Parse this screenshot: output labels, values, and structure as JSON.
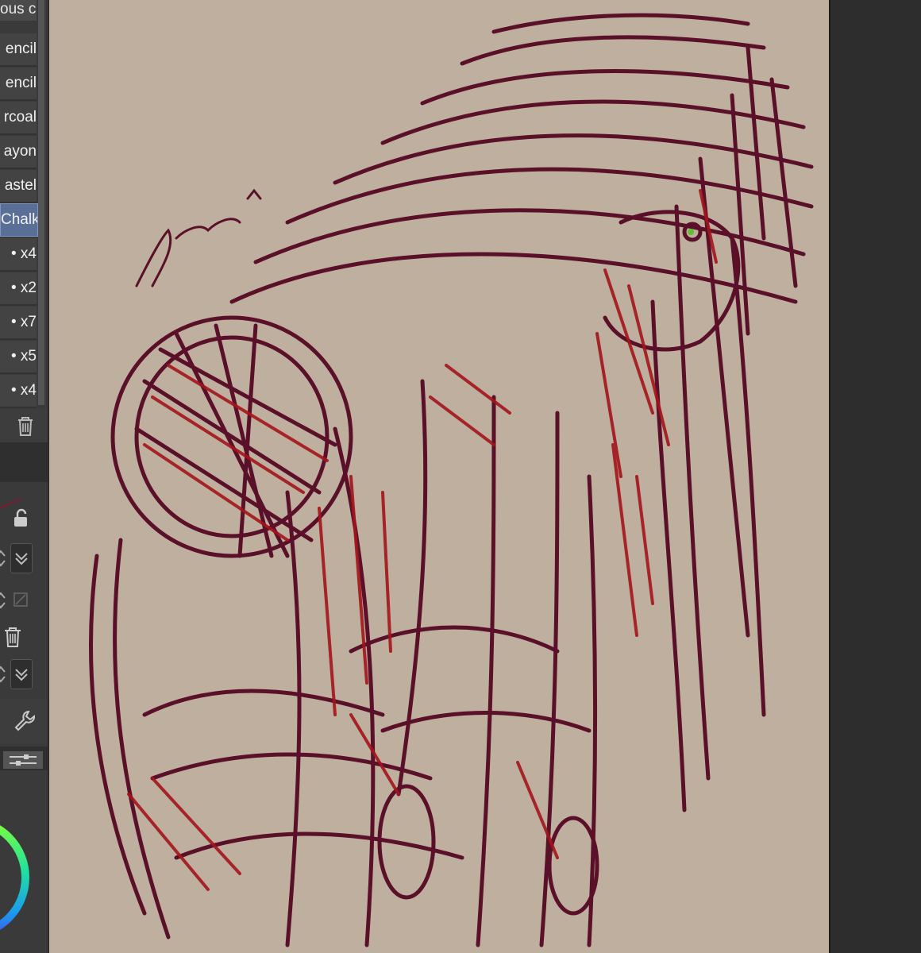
{
  "subtool_panel": {
    "header": "ous cha",
    "items": [
      {
        "label": "encil"
      },
      {
        "label": "encil"
      },
      {
        "label": "rcoal"
      },
      {
        "label": "ayon"
      },
      {
        "label": "astel"
      },
      {
        "label": "Chalk",
        "active": true
      }
    ]
  },
  "color_sets": {
    "rows": [
      {
        "label": "• x4"
      },
      {
        "label": "• x2"
      },
      {
        "label": "• x7"
      },
      {
        "label": "• x5"
      },
      {
        "label": "• x4"
      }
    ]
  },
  "icons": [
    "trash-icon",
    "lock-icon",
    "chevron-updown-icon",
    "check-icon",
    "mask-icon",
    "wrench-icon",
    "sliders-icon",
    "color-wheel-icon"
  ],
  "canvas": {
    "background_color": "#bfaf9f",
    "stroke_primary": "#5a1028",
    "stroke_accent": "#a3141b"
  }
}
